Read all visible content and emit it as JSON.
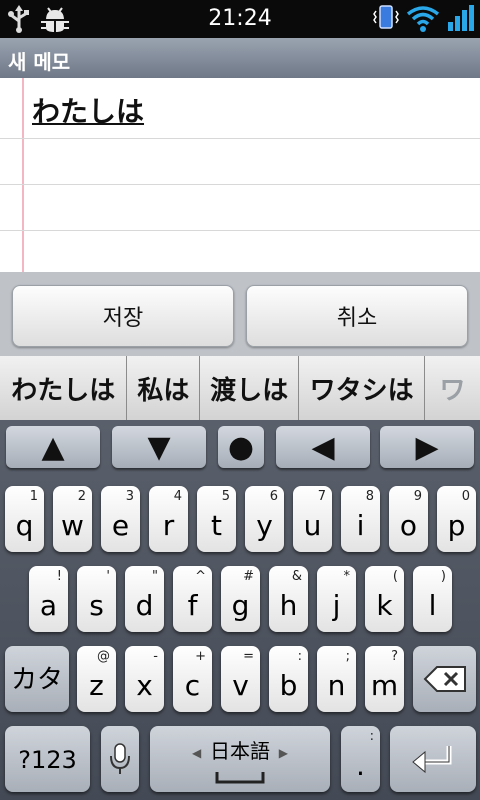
{
  "status_bar": {
    "time": "21:24",
    "icons_left": [
      "usb-icon",
      "debug-icon"
    ],
    "icons_right": [
      "vibrate-icon",
      "wifi-icon",
      "signal-icon"
    ]
  },
  "title_bar": {
    "title": "새 메모"
  },
  "note": {
    "text": "わたしは"
  },
  "buttons": {
    "save": "저장",
    "cancel": "취소"
  },
  "candidates": [
    "わたしは",
    "私は",
    "渡しは",
    "ワタシは",
    "ワ"
  ],
  "nav_keys": [
    "▲",
    "▼",
    "●",
    "◀",
    "▶"
  ],
  "keyboard": {
    "row1": [
      {
        "main": "q",
        "sub": "1"
      },
      {
        "main": "w",
        "sub": "2"
      },
      {
        "main": "e",
        "sub": "3"
      },
      {
        "main": "r",
        "sub": "4"
      },
      {
        "main": "t",
        "sub": "5"
      },
      {
        "main": "y",
        "sub": "6"
      },
      {
        "main": "u",
        "sub": "7"
      },
      {
        "main": "i",
        "sub": "8"
      },
      {
        "main": "o",
        "sub": "9"
      },
      {
        "main": "p",
        "sub": "0"
      }
    ],
    "row2": [
      {
        "main": "a",
        "sub": "!"
      },
      {
        "main": "s",
        "sub": "'"
      },
      {
        "main": "d",
        "sub": "\""
      },
      {
        "main": "f",
        "sub": "^"
      },
      {
        "main": "g",
        "sub": "#"
      },
      {
        "main": "h",
        "sub": "&"
      },
      {
        "main": "j",
        "sub": "*"
      },
      {
        "main": "k",
        "sub": "("
      },
      {
        "main": "l",
        "sub": ")"
      }
    ],
    "row3": [
      {
        "main": "z",
        "sub": "@"
      },
      {
        "main": "x",
        "sub": "-"
      },
      {
        "main": "c",
        "sub": "+"
      },
      {
        "main": "v",
        "sub": "="
      },
      {
        "main": "b",
        "sub": ":"
      },
      {
        "main": "n",
        "sub": ";"
      },
      {
        "main": "m",
        "sub": "?"
      }
    ],
    "kana_key": "カタ",
    "symbols_key": "?123",
    "space_key": "日本語",
    "period_key": ".",
    "period_sub": ":"
  },
  "colors": {
    "keyboard_bg": "#4f5560",
    "key_face": "#ffffff",
    "title_bar": "#7f8896"
  }
}
